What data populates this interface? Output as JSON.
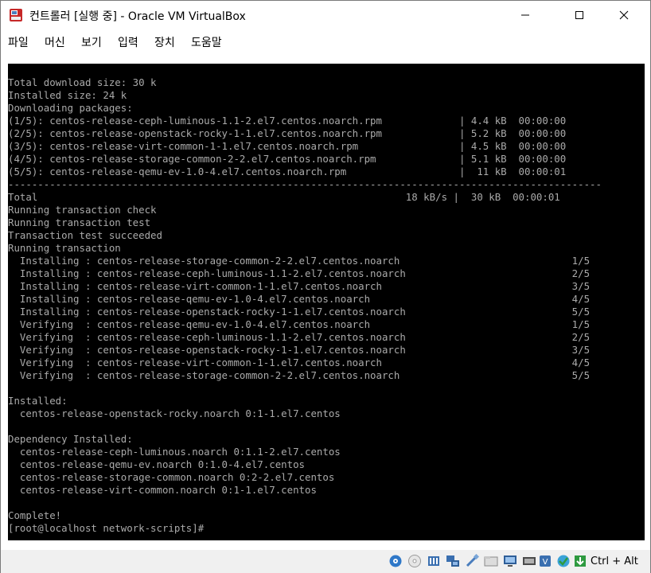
{
  "window": {
    "title": "컨트롤러 [실행 중] - Oracle VM VirtualBox"
  },
  "menu": {
    "items": [
      "파일",
      "머신",
      "보기",
      "입력",
      "장치",
      "도움말"
    ]
  },
  "console": {
    "lines": [
      "Total download size: 30 k",
      "Installed size: 24 k",
      "Downloading packages:",
      "(1/5): centos-release-ceph-luminous-1.1-2.el7.centos.noarch.rpm             | 4.4 kB  00:00:00",
      "(2/5): centos-release-openstack-rocky-1-1.el7.centos.noarch.rpm             | 5.2 kB  00:00:00",
      "(3/5): centos-release-virt-common-1-1.el7.centos.noarch.rpm                 | 4.5 kB  00:00:00",
      "(4/5): centos-release-storage-common-2-2.el7.centos.noarch.rpm              | 5.1 kB  00:00:00",
      "(5/5): centos-release-qemu-ev-1.0-4.el7.centos.noarch.rpm                   |  11 kB  00:00:01",
      "----------------------------------------------------------------------------------------------------",
      "Total                                                              18 kB/s |  30 kB  00:00:01",
      "Running transaction check",
      "Running transaction test",
      "Transaction test succeeded",
      "Running transaction",
      "  Installing : centos-release-storage-common-2-2.el7.centos.noarch                             1/5",
      "  Installing : centos-release-ceph-luminous-1.1-2.el7.centos.noarch                            2/5",
      "  Installing : centos-release-virt-common-1-1.el7.centos.noarch                                3/5",
      "  Installing : centos-release-qemu-ev-1.0-4.el7.centos.noarch                                  4/5",
      "  Installing : centos-release-openstack-rocky-1-1.el7.centos.noarch                            5/5",
      "  Verifying  : centos-release-qemu-ev-1.0-4.el7.centos.noarch                                  1/5",
      "  Verifying  : centos-release-ceph-luminous-1.1-2.el7.centos.noarch                            2/5",
      "  Verifying  : centos-release-openstack-rocky-1-1.el7.centos.noarch                            3/5",
      "  Verifying  : centos-release-virt-common-1-1.el7.centos.noarch                                4/5",
      "  Verifying  : centos-release-storage-common-2-2.el7.centos.noarch                             5/5",
      "",
      "Installed:",
      "  centos-release-openstack-rocky.noarch 0:1-1.el7.centos",
      "",
      "Dependency Installed:",
      "  centos-release-ceph-luminous.noarch 0:1.1-2.el7.centos",
      "  centos-release-qemu-ev.noarch 0:1.0-4.el7.centos",
      "  centos-release-storage-common.noarch 0:2-2.el7.centos",
      "  centos-release-virt-common.noarch 0:1-1.el7.centos",
      "",
      "Complete!",
      "[root@localhost network-scripts]#"
    ]
  },
  "statusbar": {
    "icons": [
      "hard-disk-icon",
      "optical-drive-icon",
      "audio-icon",
      "network-icon",
      "usb-icon",
      "shared-folders-icon",
      "display-icon",
      "video-capture-icon",
      "cpu-icon",
      "guest-additions-icon",
      "mouse-integration-icon",
      "keyboard-capture-icon"
    ],
    "host_key": "Ctrl + Alt"
  },
  "colors": {
    "console_bg": "#000000",
    "console_text": "#aaaaaa",
    "titlebar_bg": "#ffffff",
    "statusbar_bg": "#f0f0f0"
  }
}
